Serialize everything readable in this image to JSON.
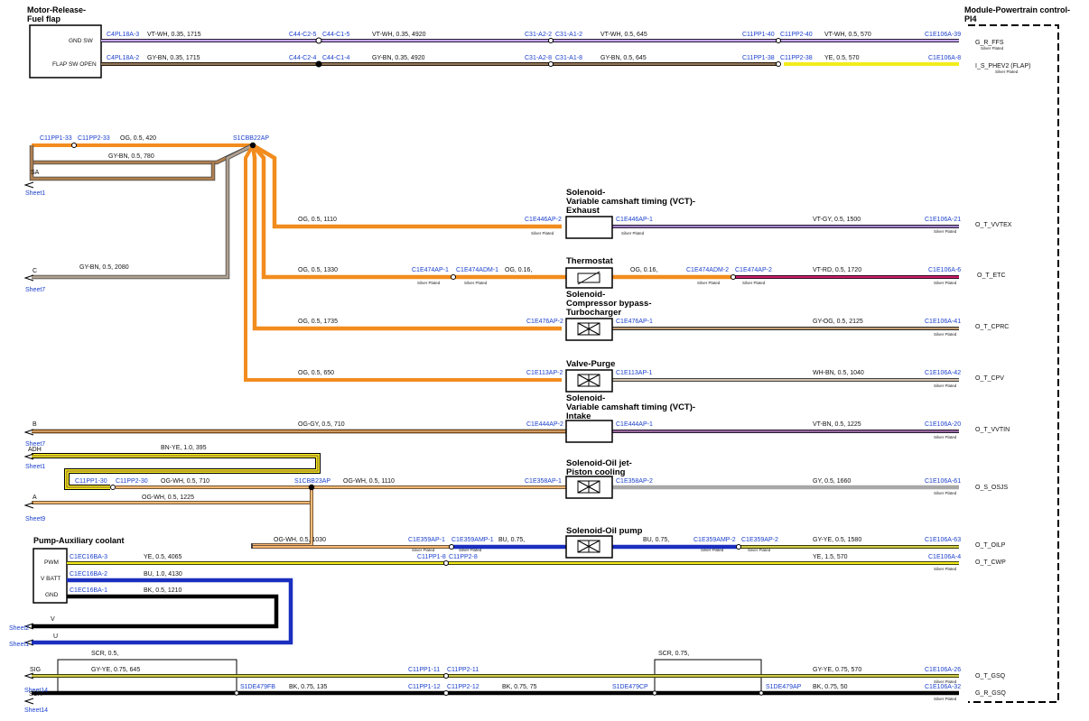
{
  "title_left": [
    "Motor-Release-",
    "Fuel flap"
  ],
  "title_right": [
    "Module-Powertrain control-",
    "PI4"
  ],
  "silver": "Silver Plated",
  "fuel_flap": {
    "pins": [
      "GND SW",
      "FLAP SW OPEN"
    ],
    "row1": [
      "C4PL18A-3",
      "VT-WH, 0.35, 1715",
      "C44-C2-5",
      "C44-C1-5",
      "VT-WH, 0.35, 4920",
      "C31-A2-2",
      "C31-A1-2",
      "VT-WH, 0.5, 645",
      "C11PP1-40",
      "C11PP2-40",
      "VT-WH, 0.5, 570",
      "C1E106A-39",
      "G_R_FFS"
    ],
    "row2": [
      "C4PL18A-2",
      "GY-BN, 0.35, 1715",
      "C44-C2-4",
      "C44-C1-4",
      "GY-BN, 0.35, 4920",
      "C31-A2-8",
      "C31-A1-8",
      "GY-BN, 0.5, 645",
      "C11PP1-38",
      "C11PP2-38",
      "YE, 0.5, 570",
      "C1E106A-8",
      "I_S_PHEV2 (FLAP)"
    ]
  },
  "splice1": {
    "name": "S1CBB22AP",
    "top": [
      "C11PP1-33",
      "C11PP2-33",
      "OG, 0.5, 420"
    ],
    "sa": [
      "GY-BN, 0.5, 780",
      "SA",
      "Sheet1"
    ],
    "c": [
      "GY-BN, 0.5, 2080",
      "C",
      "Sheet7"
    ]
  },
  "components": {
    "vct_ex": [
      "Solenoid-",
      "Variable camshaft timing (VCT)-",
      "Exhaust"
    ],
    "thermo": [
      "Thermostat"
    ],
    "cbp": [
      "Solenoid-",
      "Compressor bypass-",
      "Turbocharger"
    ],
    "purge": [
      "Valve-Purge"
    ],
    "vct_in": [
      "Solenoid-",
      "Variable camshaft timing (VCT)-",
      "Intake"
    ],
    "oiljet": [
      "Solenoid-Oil jet-",
      "Piston cooling"
    ],
    "oilpump": [
      "Solenoid-Oil pump"
    ]
  },
  "circuits": {
    "vvtex": [
      "OG, 0.5, 1110",
      "C1E446AP-2",
      "C1E446AP-1",
      "VT-GY, 0.5, 1500",
      "C1E106A-21",
      "O_T_VVTEX"
    ],
    "etc": [
      "OG, 0.5, 1330",
      "C1E474AP-1",
      "C1E474ADM-1",
      "OG, 0.16,",
      "OG, 0.16,",
      "C1E474ADM-2",
      "C1E474AP-2",
      "VT-RD, 0.5, 1720",
      "C1E106A-6",
      "O_T_ETC"
    ],
    "cprc": [
      "OG, 0.5, 1735",
      "C1E476AP-2",
      "C1E476AP-1",
      "GY-OG, 0.5, 2125",
      "C1E106A-41",
      "O_T_CPRC"
    ],
    "cpv": [
      "OG, 0.5, 650",
      "C1E113AP-2",
      "C1E113AP-1",
      "WH-BN, 0.5, 1040",
      "C1E106A-42",
      "O_T_CPV"
    ],
    "vvtin": [
      "B",
      "Sheet7",
      "OG-GY, 0.5, 710",
      "C1E444AP-2",
      "C1E444AP-1",
      "VT-BN, 0.5, 1225",
      "C1E106A-20",
      "O_T_VVTIN"
    ],
    "osjs": [
      "ADH",
      "Sheet1",
      "BN-YE, 1.0, 395",
      "C11PP1-30",
      "C11PP2-30",
      "OG-WH, 0.5, 710",
      "S1CBB23AP",
      "OG-WH, 0.5, 1110",
      "C1E358AP-1",
      "C1E358AP-2",
      "GY, 0.5, 1660",
      "C1E106A-61",
      "O_S_OSJS",
      "A",
      "Sheet9",
      "OG-WH, 0.5, 1225"
    ],
    "oilp": [
      "OG-WH, 0.5, 1030",
      "C1E359AP-1",
      "C1E359AMP-1",
      "BU, 0.75,",
      "BU, 0.75,",
      "C1E359AMP-2",
      "C1E359AP-2",
      "GY-YE, 0.5, 1580",
      "C1E106A-63",
      "O_T_OILP"
    ]
  },
  "pump": {
    "title": "Pump-Auxiliary coolant",
    "pins": [
      "PWM",
      "V BATT",
      "GND"
    ],
    "cwp": [
      "C1EC16BA-3",
      "YE, 0.5, 4065",
      "C11PP1-8",
      "C11PP2-8",
      "YE, 1.5, 570",
      "C1E106A-4",
      "O_T_CWP"
    ],
    "vbatt": [
      "C1EC16BA-2",
      "BU, 1.0, 4130"
    ],
    "gnd": [
      "C1EC16BA-1",
      "BK, 0.5, 1210"
    ],
    "v": [
      "V",
      "Sheet2"
    ],
    "u": [
      "U",
      "Sheet1"
    ]
  },
  "gsq": {
    "scr": [
      "SCR, 0.5,",
      "SCR, 0.75,"
    ],
    "sig": [
      "SIG",
      "Sheet14",
      "GY-YE, 0.75, 645",
      "C11PP1-11",
      "C11PP2-11",
      "GY-YE, 0.75, 570",
      "C1E106A-26",
      "O_T_GSQ"
    ],
    "gnd": [
      "SCR",
      "Sheet14",
      "S1DE479FB",
      "BK, 0.75, 135",
      "C11PP1-12",
      "C11PP2-12",
      "BK, 0.75, 75",
      "S1DE479CP",
      "S1DE479AP",
      "BK, 0.75, 50",
      "C1E106A-32",
      "G_R_GSQ"
    ]
  },
  "wire_colors": {
    "OG": "#f28c1e",
    "VT": "#9b5de5",
    "WH": "#ffffff",
    "GY": "#9a9a9a",
    "BN": "#8b5a2b",
    "YE": "#f2ec1d",
    "BU": "#1a2fbf",
    "BK": "#000000",
    "RD": "#e0245e"
  }
}
